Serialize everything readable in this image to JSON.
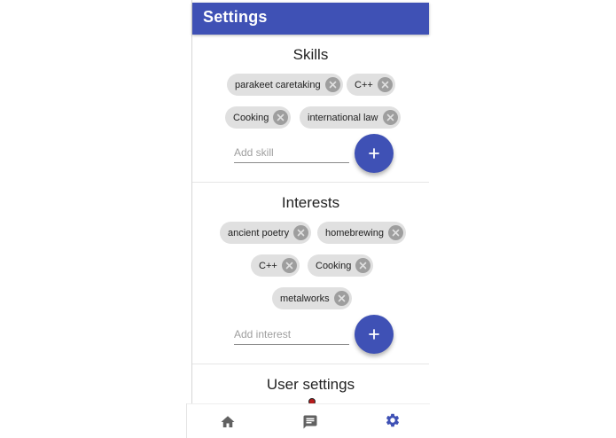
{
  "app": {
    "title": "Settings"
  },
  "skills": {
    "title": "Skills",
    "chips": [
      {
        "label": "parakeet caretaking"
      },
      {
        "label": "C++"
      },
      {
        "label": "Cooking"
      },
      {
        "label": "international law"
      }
    ],
    "input": {
      "placeholder": "Add skill",
      "value": ""
    },
    "add_button_icon": "plus-icon"
  },
  "interests": {
    "title": "Interests",
    "chips": [
      {
        "label": "ancient poetry"
      },
      {
        "label": "homebrewing"
      },
      {
        "label": "C++"
      },
      {
        "label": "Cooking"
      },
      {
        "label": "metalworks"
      }
    ],
    "input": {
      "placeholder": "Add interest",
      "value": ""
    },
    "add_button_icon": "plus-icon"
  },
  "user_settings": {
    "title": "User settings"
  },
  "bottom_nav": {
    "items": [
      {
        "icon": "home-icon",
        "active": false
      },
      {
        "icon": "chat-icon",
        "active": false
      },
      {
        "icon": "gear-icon",
        "active": true
      }
    ]
  },
  "colors": {
    "primary": "#3f51b5",
    "chip_bg": "#e0e0e0",
    "chip_remove": "#9e9e9e",
    "nav_inactive": "#616161"
  }
}
